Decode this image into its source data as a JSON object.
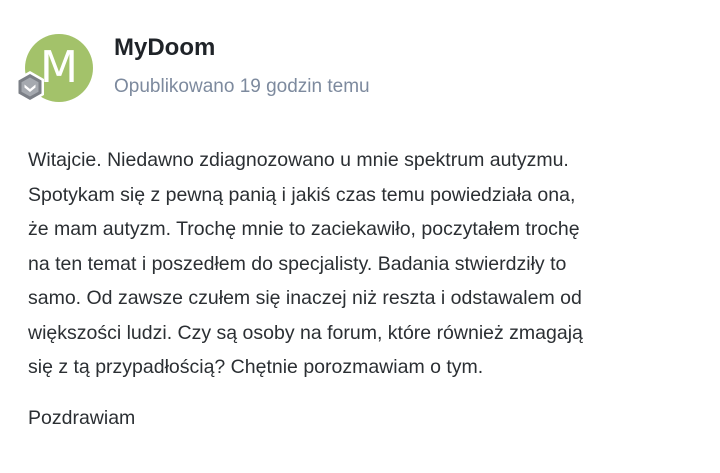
{
  "author": {
    "name": "MyDoom",
    "avatar_letter": "M",
    "avatar_color": "#a3c26a",
    "badge_icon": "rank-badge-icon"
  },
  "meta": {
    "posted": "Opublikowano 19 godzin temu"
  },
  "body": {
    "lines": [
      "Witajcie. Niedawno zdiagnozowano u mnie spektrum autyzmu.",
      "Spotykam się z pewną panią  i jakiś czas temu powiedziała ona,",
      "że mam autyzm. Trochę mnie to zaciekawiło, poczytałem trochę",
      "na ten temat i poszedłem do specjalisty. Badania stwierdziły to",
      "samo. Od zawsze czułem się inaczej niż reszta i odstawalem od",
      "większości ludzi. Czy są osoby na forum, które również zmagają",
      "się z tą przypadłością? Chętnie porozmawiam o tym."
    ],
    "signature": "Pozdrawiam"
  }
}
